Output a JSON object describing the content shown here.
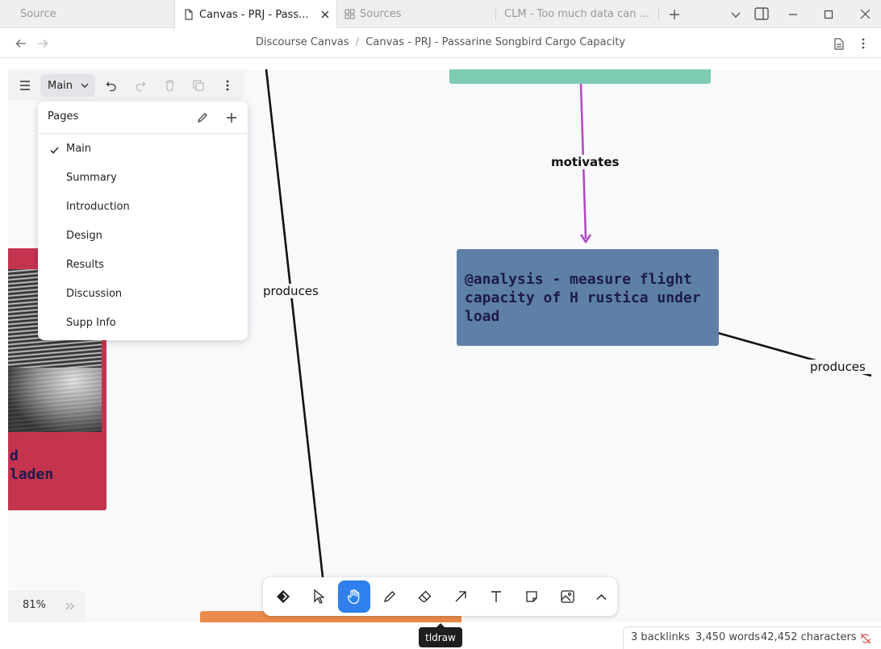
{
  "tabs": [
    {
      "title": "Source",
      "active": false,
      "icon": "none"
    },
    {
      "title": "Canvas - PRJ - Pass...",
      "active": true,
      "icon": "document-icon"
    },
    {
      "title": "Sources",
      "active": false,
      "icon": "grid-icon"
    },
    {
      "title": "CLM - Too much data can ...",
      "active": false,
      "icon": "none"
    }
  ],
  "breadcrumb": {
    "parent": "Discourse Canvas",
    "separator": "/",
    "current": "Canvas - PRJ - Passarine Songbird Cargo Capacity"
  },
  "toolbar": {
    "page_select": "Main"
  },
  "pages_menu": {
    "title": "Pages",
    "items": [
      "Main",
      "Summary",
      "Introduction",
      "Design",
      "Results",
      "Discussion",
      "Supp Info"
    ],
    "selected": "Main"
  },
  "canvas": {
    "analysis_node": "@analysis - measure flight capacity of H rustica under load",
    "left_node_line1": "d",
    "left_node_line2": "laden",
    "edge_motivates": "motivates",
    "edge_produces_left": "produces",
    "edge_produces_right": "produces",
    "colors": {
      "teal": "#7ecbb4",
      "blue": "#5e80a6",
      "red": "#c5344f",
      "orange": "#ea8a4a",
      "purple": "#b146c2"
    }
  },
  "zoom": {
    "level": "81%"
  },
  "tooltip": "tldraw",
  "status": {
    "backlinks": "3 backlinks",
    "words": "3,450 words",
    "characters": "42,452 characters"
  },
  "accent": "#2f80ed"
}
